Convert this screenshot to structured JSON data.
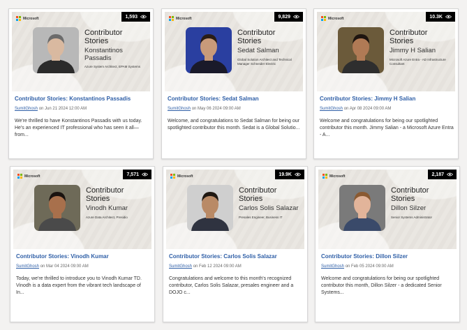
{
  "brand": "Microsoft",
  "banner_heading": "Contributor Stories",
  "cards": [
    {
      "views": "1,593",
      "name": "Konstantinos Passadis",
      "role": "Azure System Architect, EPAM Systems",
      "title": "Contributor Stories: Konstantinos Passadis",
      "author": "SumitGhosh",
      "date": "on Jun 21 2024 12:00 AM",
      "excerpt": "We're thrilled to have Konstantinos Passadis with us today. He's an experienced IT professional who has seen it all—from...",
      "skin": "#d9b9a0",
      "hair": "#6b6b6b",
      "shirt": "#2b2b2b",
      "bg": "#b8b8b8"
    },
    {
      "views": "9,829",
      "name": "Sedat Salman",
      "role": "Global Solution Architect and Technical Manager Schneider Electric",
      "title": "Contributor Stories: Sedat Salman",
      "author": "SumitGhosh",
      "date": "on May 06 2024 09:00 AM",
      "excerpt": "Welcome, and congratulations to Sedat Salman for being our spotlighted contributor this month. Sedat is a Global Solutio...",
      "skin": "#c89a7a",
      "hair": "#2a1d16",
      "shirt": "#1a1a2a",
      "bg": "#2a3fa0"
    },
    {
      "views": "10.3K",
      "name": "Jimmy H Salian",
      "role": "Microsoft Azure Entra - AD Infrastructure Consultant",
      "title": "Contributor Stories: Jimmy H Salian",
      "author": "SumitGhosh",
      "date": "on Apr 08 2024 09:00 AM",
      "excerpt": "Welcome and congratulations for being our spotlighted contributor this month. Jimmy Salian - a Microsoft Azure Entra - A...",
      "skin": "#b07a55",
      "hair": "#1e1510",
      "shirt": "#2e2e2e",
      "bg": "#6b5a3a"
    },
    {
      "views": "7,571",
      "name": "Vinodh Kumar",
      "role": "Azure Data Architect, Presidio",
      "title": "Contributor Stories: Vinodh Kumar",
      "author": "SumitGhosh",
      "date": "on Mar 04 2024 09:00 AM",
      "excerpt": "Today, we're thrilled to introduce you to Vinodh Kumar TD. Vinodh is a data expert from the vibrant tech landscape of In...",
      "skin": "#a8704c",
      "hair": "#1a1310",
      "shirt": "#4a4a4a",
      "bg": "#6e6a58"
    },
    {
      "views": "19.9K",
      "name": "Carlos Solis Salazar",
      "role": "Presales Engineer, Business IT",
      "title": "Contributor Stories: Carlos Solis Salazar",
      "author": "SumitGhosh",
      "date": "on Feb 12 2024 09:00 AM",
      "excerpt": "Congratulations and welcome to this month's recognized contributor, Carlos Solis Salazar, presales engineer and a DOJO c...",
      "skin": "#b98a66",
      "hair": "#1f1812",
      "shirt": "#2f3340",
      "bg": "#cfcfcf"
    },
    {
      "views": "2,187",
      "name": "Dillon Silzer",
      "role": "Senior Systems Administrator",
      "title": "Contributor Stories: Dillon Silzer",
      "author": "SumitGhosh",
      "date": "on Feb 05 2024 09:00 AM",
      "excerpt": "Welcome and congratulations for being our spotlighted contributor this month, Dillon Silzer - a dedicated Senior Systems...",
      "skin": "#e2b49a",
      "hair": "#8a5a32",
      "shirt": "#3a4a6a",
      "bg": "#7a7a7a"
    }
  ]
}
